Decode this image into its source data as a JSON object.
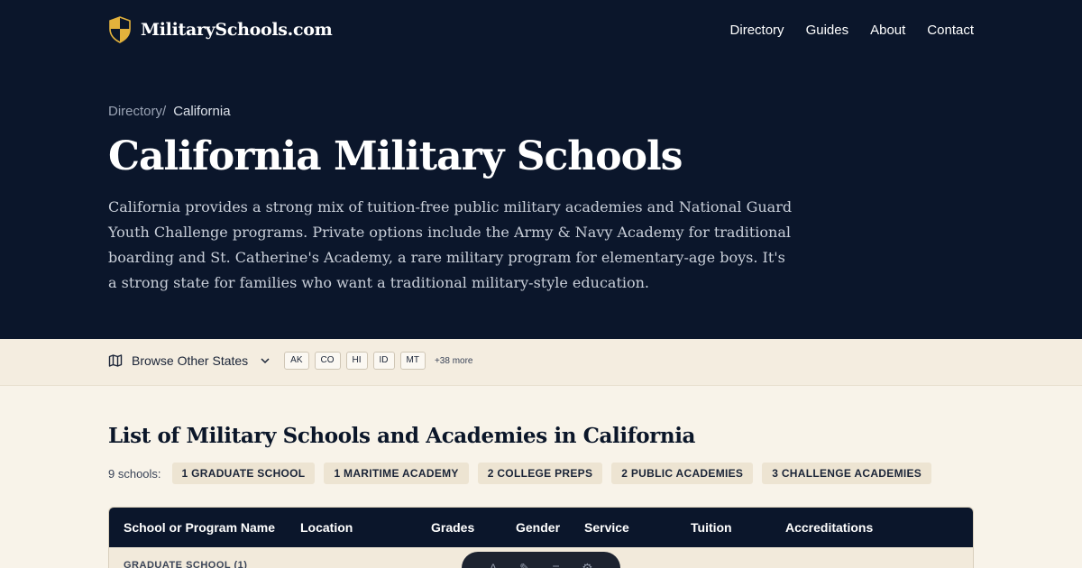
{
  "nav": {
    "logo_text": "MilitarySchools.com",
    "links": [
      "Directory",
      "Guides",
      "About",
      "Contact"
    ]
  },
  "breadcrumb": {
    "parent": "Directory/",
    "current": "California"
  },
  "hero": {
    "title": "California Military Schools",
    "intro": "California provides a strong mix of tuition-free public military academies and National Guard Youth Challenge programs. Private options include the Army & Navy Academy for traditional boarding and St. Catherine's Academy, a rare military program for elementary-age boys. It's a strong state for families who want a traditional military-style education."
  },
  "states": {
    "label": "Browse Other States",
    "chips": [
      "AK",
      "CO",
      "HI",
      "ID",
      "MT"
    ],
    "more": "+38 more"
  },
  "list": {
    "title": "List of Military Schools and Academies in California",
    "count_label": "9 schools:",
    "chips": [
      "1 GRADUATE SCHOOL",
      "1 MARITIME ACADEMY",
      "2 COLLEGE PREPS",
      "2 PUBLIC ACADEMIES",
      "3 CHALLENGE ACADEMIES"
    ]
  },
  "table": {
    "columns": [
      "School or Program Name",
      "Location",
      "Grades",
      "Gender",
      "Service",
      "Tuition",
      "Accreditations"
    ],
    "group_label": "GRADUATE SCHOOL (1)"
  },
  "colors": {
    "hero_bg": "#0b162b",
    "cream_bg": "#f8f3e9",
    "shield_gold": "#e3b23c"
  },
  "icons": [
    "shield-logo-icon",
    "map-icon",
    "chevron-down-icon"
  ]
}
